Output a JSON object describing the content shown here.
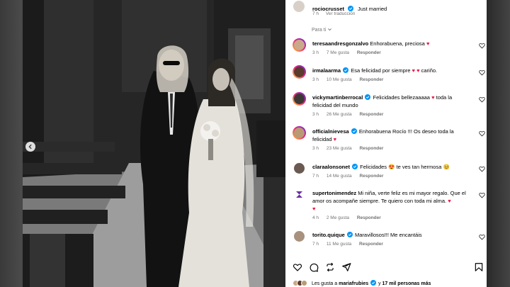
{
  "post": {
    "username": "rociocrusset",
    "caption": "Just married",
    "time": "7 h",
    "translate_label": "Ver traducción"
  },
  "section_label": "Para ti",
  "comments": [
    {
      "username": "teresaandresgonzalvo",
      "text": "Enhorabuena, preciosa",
      "emoji": "♥",
      "time": "3 h",
      "likes": "7 Me gusta",
      "reply": "Responder"
    },
    {
      "username": "irmalaarma",
      "text": "Esa felicidad por siempre",
      "emoji": "♥ ♥",
      "text2": "cariño.",
      "time": "3 h",
      "likes": "10 Me gusta",
      "reply": "Responder"
    },
    {
      "username": "vickymartinberrocal",
      "text": "Felicidades bellezaaaaa",
      "emoji": "♥",
      "text2": "toda la felicidad del mundo",
      "time": "3 h",
      "likes": "26 Me gusta",
      "reply": "Responder"
    },
    {
      "username": "officialnievesa",
      "text": "Enhorabuena Rocío !!! Os deseo toda la felicidad",
      "emoji": "♥",
      "time": "3 h",
      "likes": "23 Me gusta",
      "reply": "Responder"
    },
    {
      "username": "claraalonsonet",
      "text": "Felicidades",
      "emoji": "😍",
      "text2": "te ves tan hermosa",
      "emoji2": "🥹",
      "time": "7 h",
      "likes": "14 Me gusta",
      "reply": "Responder"
    },
    {
      "username": "supertonimendez",
      "text": "Mi niña, verte feliz es mi mayor regalo. Que el amor os acompañe siempre. Te quiero con toda mi alma.",
      "emoji": "♥",
      "emoji_line2": "♥",
      "time": "4 h",
      "likes": "2 Me gusta",
      "reply": "Responder"
    },
    {
      "username": "torito.quique",
      "text": "Maravillosos!!! Me encantáis",
      "time": "7 h",
      "likes": "11 Me gusta",
      "reply": "Responder"
    }
  ],
  "likes_summary": {
    "prefix": "Les gusta a",
    "user": "mariafrubies",
    "suffix": "y",
    "count": "17 mil personas más"
  },
  "icons": {
    "like": "heart-outline-icon",
    "comment": "comment-bubble-icon",
    "share": "repost-icon",
    "send": "paper-plane-icon",
    "save": "bookmark-icon",
    "verified": "verified-badge-icon",
    "prev": "chevron-left-icon",
    "dropdown": "chevron-down-icon"
  },
  "colors": {
    "verified": "#0095f6",
    "heart": "#ed1944",
    "meta": "#737373"
  }
}
